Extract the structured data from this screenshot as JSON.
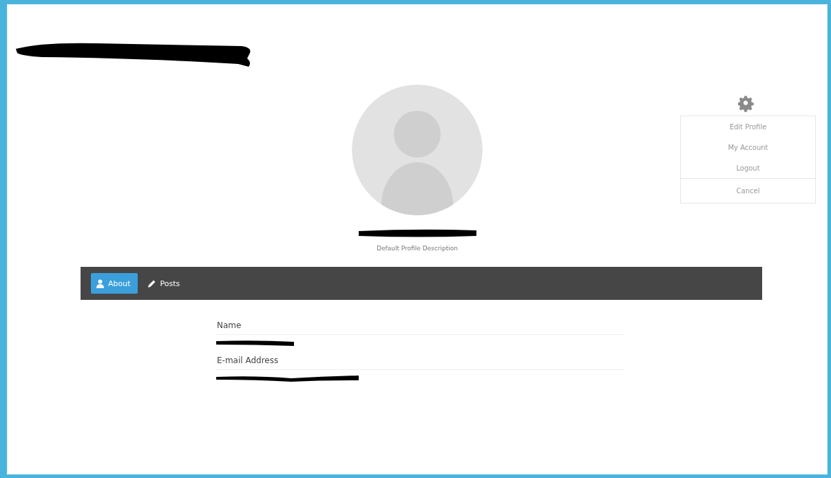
{
  "profile": {
    "description": "Default Profile Description"
  },
  "settings_menu": {
    "items": [
      {
        "label": "Edit Profile",
        "kind": "item"
      },
      {
        "label": "My Account",
        "kind": "item"
      },
      {
        "label": "Logout",
        "kind": "item"
      },
      {
        "label": "Cancel",
        "kind": "cancel"
      }
    ]
  },
  "tabs": [
    {
      "label": "About",
      "kind": "about",
      "selected": true
    },
    {
      "label": "Posts",
      "kind": "posts",
      "selected": false
    }
  ],
  "fields": [
    {
      "label": "Name"
    },
    {
      "label": "E-mail Address"
    }
  ]
}
